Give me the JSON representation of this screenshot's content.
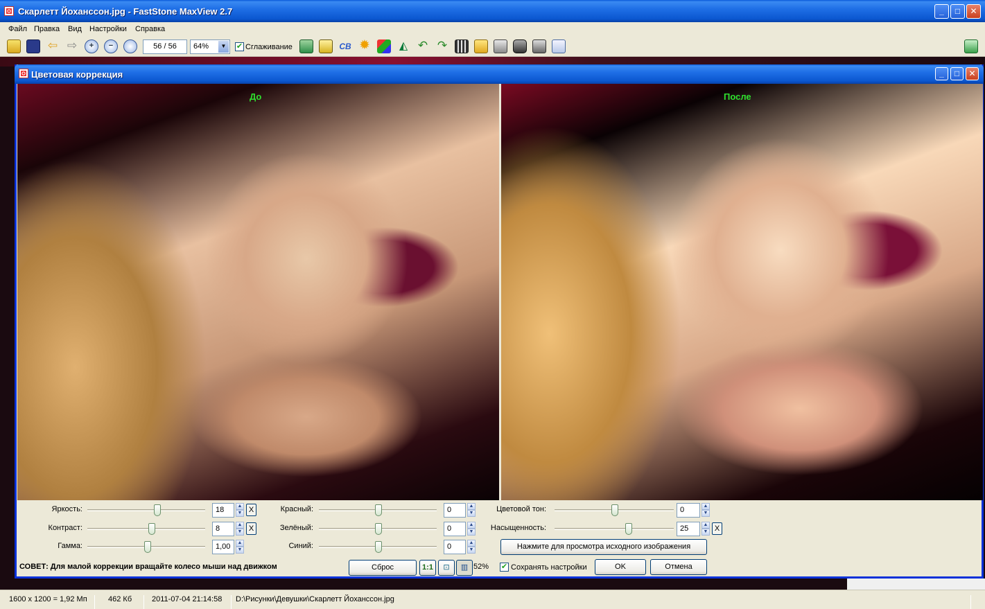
{
  "window": {
    "title": "Скарлетт Йоханссон.jpg - FastStone MaxView 2.7"
  },
  "menu": [
    "Файл",
    "Правка",
    "Вид",
    "Настройки",
    "Справка"
  ],
  "toolbar": {
    "page_counter": "56 / 56",
    "zoom_value": "64%",
    "smoothing_label": "Сглаживание",
    "smoothing_checked": true
  },
  "dialog": {
    "title": "Цветовая коррекция",
    "before_label": "До",
    "after_label": "После",
    "sliders_left": [
      {
        "label": "Яркость:",
        "value": "18",
        "level": 0.6,
        "reset": "X"
      },
      {
        "label": "Контраст:",
        "value": "8",
        "level": 0.55,
        "reset": "X"
      },
      {
        "label": "Гамма:",
        "value": "1,00",
        "level": 0.5
      }
    ],
    "sliders_mid": [
      {
        "label": "Красный:",
        "value": "0",
        "level": 0.5
      },
      {
        "label": "Зелёный:",
        "value": "0",
        "level": 0.5
      },
      {
        "label": "Синий:",
        "value": "0",
        "level": 0.5
      }
    ],
    "sliders_right": [
      {
        "label": "Цветовой тон:",
        "value": "0",
        "level": 0.5
      },
      {
        "label": "Насыщенность:",
        "value": "25",
        "level": 0.62,
        "reset": "X"
      }
    ],
    "preview_button": "Нажмите для просмотра исходного изображения",
    "tip": "СОВЕТ: Для малой коррекции вращайте колесо мыши над движком",
    "reset_button": "Сброс",
    "one_to_one": "1:1",
    "zoom_percent": "52%",
    "save_settings_label": "Сохранять настройки",
    "save_settings_checked": true,
    "ok_button": "OK",
    "cancel_button": "Отмена"
  },
  "status": {
    "dimensions": "1600 x 1200 = 1,92 Мп",
    "filesize": "462 Кб",
    "datetime": "2011-07-04 21:14:58",
    "path": "D:\\Рисунки\\Девушки\\Скарлетт Йоханссон.jpg"
  },
  "colors": {
    "title_blue": "#0b57d0",
    "label_green": "#2ee02e"
  }
}
